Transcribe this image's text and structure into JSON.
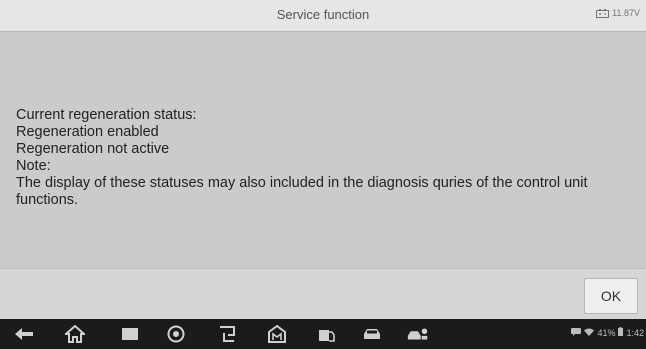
{
  "header": {
    "title": "Service function",
    "battery_voltage": "11.87V",
    "battery_icon": "battery-icon"
  },
  "message": {
    "lines": [
      "Current regeneration status:",
      "Regeneration enabled",
      "Regeneration not active",
      "Note:",
      "The display of these statuses may also included in the diagnosis quries of the control unit functions."
    ]
  },
  "actions": {
    "ok_label": "OK"
  },
  "navbar": {
    "icons": [
      "back-icon",
      "home-icon",
      "recent-apps-icon",
      "browser-icon",
      "remote-desktop-icon",
      "maxifix-icon",
      "vehicle-menu-icon",
      "car-icon",
      "vehicle-service-icon"
    ]
  },
  "status_bar": {
    "battery_percent": "41%",
    "time": "1:42"
  },
  "colors": {
    "content_bg": "#cbcbcb",
    "navbar_bg": "#1b1b1b",
    "titlebar_bg": "#e6e6e6"
  }
}
